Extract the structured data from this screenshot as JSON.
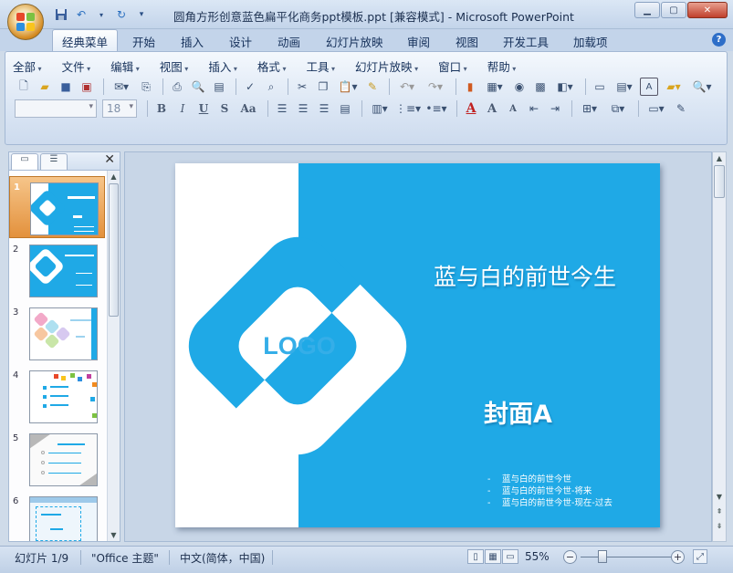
{
  "window": {
    "title": "圆角方形创意蓝色扁平化商务ppt模板.ppt [兼容模式] - Microsoft PowerPoint"
  },
  "quick_access": {
    "icons": [
      "save-icon",
      "undo-icon",
      "redo-icon",
      "customize-icon"
    ]
  },
  "ribbon_tabs": [
    {
      "label": "经典菜单",
      "active": true
    },
    {
      "label": "开始"
    },
    {
      "label": "插入"
    },
    {
      "label": "设计"
    },
    {
      "label": "动画"
    },
    {
      "label": "幻灯片放映"
    },
    {
      "label": "审阅"
    },
    {
      "label": "视图"
    },
    {
      "label": "开发工具"
    },
    {
      "label": "加载项"
    }
  ],
  "classic_menu": {
    "items": [
      "全部",
      "文件",
      "编辑",
      "视图",
      "插入",
      "格式",
      "工具",
      "幻灯片放映",
      "窗口",
      "帮助"
    ]
  },
  "format_bar": {
    "font_name": "",
    "font_size": "18",
    "bold": "B",
    "italic": "I",
    "underline": "U",
    "shadow": "S",
    "change_case": "Aa",
    "font_color": "A",
    "grow_font": "A",
    "shrink_font": "A"
  },
  "slides_panel": {
    "thumbnails": [
      {
        "number": "1",
        "selected": true
      },
      {
        "number": "2"
      },
      {
        "number": "3"
      },
      {
        "number": "4"
      },
      {
        "number": "5"
      },
      {
        "number": "6"
      }
    ]
  },
  "slide": {
    "logo_text": "LOGO",
    "title": "蓝与白的前世今生",
    "subtitle": "封面A",
    "bullets": [
      "蓝与白的前世今世",
      "蓝与白的前世今世-将来",
      "蓝与白的前世今世-现在-过去"
    ],
    "bullet_marker": "-",
    "colors": {
      "primary": "#1fa9e6",
      "secondary": "#ffffff"
    }
  },
  "status_bar": {
    "slide_info": "幻灯片 1/9",
    "theme": "\"Office 主题\"",
    "language": "中文(简体，中国)",
    "zoom": "55%"
  }
}
